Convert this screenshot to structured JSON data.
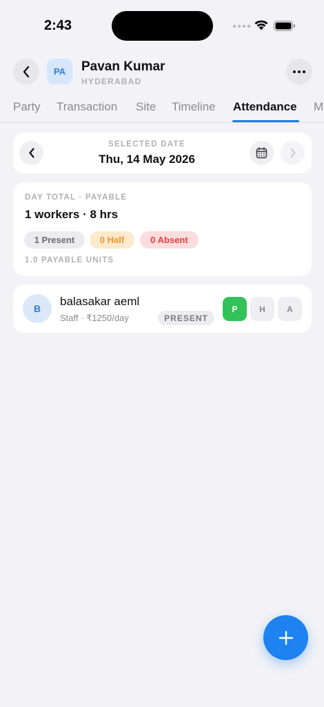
{
  "status_bar": {
    "time": "2:43"
  },
  "header": {
    "avatar_initials": "PA",
    "name": "Pavan Kumar",
    "city": "HYDERABAD"
  },
  "tabs": [
    {
      "label": "Party",
      "active": false
    },
    {
      "label": "Transaction",
      "active": false
    },
    {
      "label": "Site",
      "active": false
    },
    {
      "label": "Timeline",
      "active": false
    },
    {
      "label": "Attendance",
      "active": true
    },
    {
      "label": "M",
      "active": false
    }
  ],
  "date_selector": {
    "label": "SELECTED DATE",
    "value": "Thu, 14 May 2026"
  },
  "day_total": {
    "label": "DAY TOTAL · PAYABLE",
    "summary": "1 workers · 8 hrs",
    "present": "1 Present",
    "half": "0 Half",
    "absent": "0 Absent",
    "payable_units": "1.0 PAYABLE UNITS"
  },
  "workers": [
    {
      "initial": "B",
      "name": "balasakar aeml",
      "meta": "Staff · ₹1250/day",
      "status": "PRESENT",
      "buttons": {
        "present": "P",
        "half": "H",
        "absent": "A"
      }
    }
  ],
  "colors": {
    "accent": "#1e82f0",
    "present_green": "#33c25a",
    "half_orange": "#f0962a",
    "absent_red": "#e84040",
    "background": "#f2f2f7"
  },
  "icons": {
    "back": "chevron-left-icon",
    "more": "ellipsis-icon",
    "prev_date": "chevron-left-icon",
    "calendar": "calendar-icon",
    "next_date": "chevron-right-icon",
    "fab": "plus-icon"
  }
}
